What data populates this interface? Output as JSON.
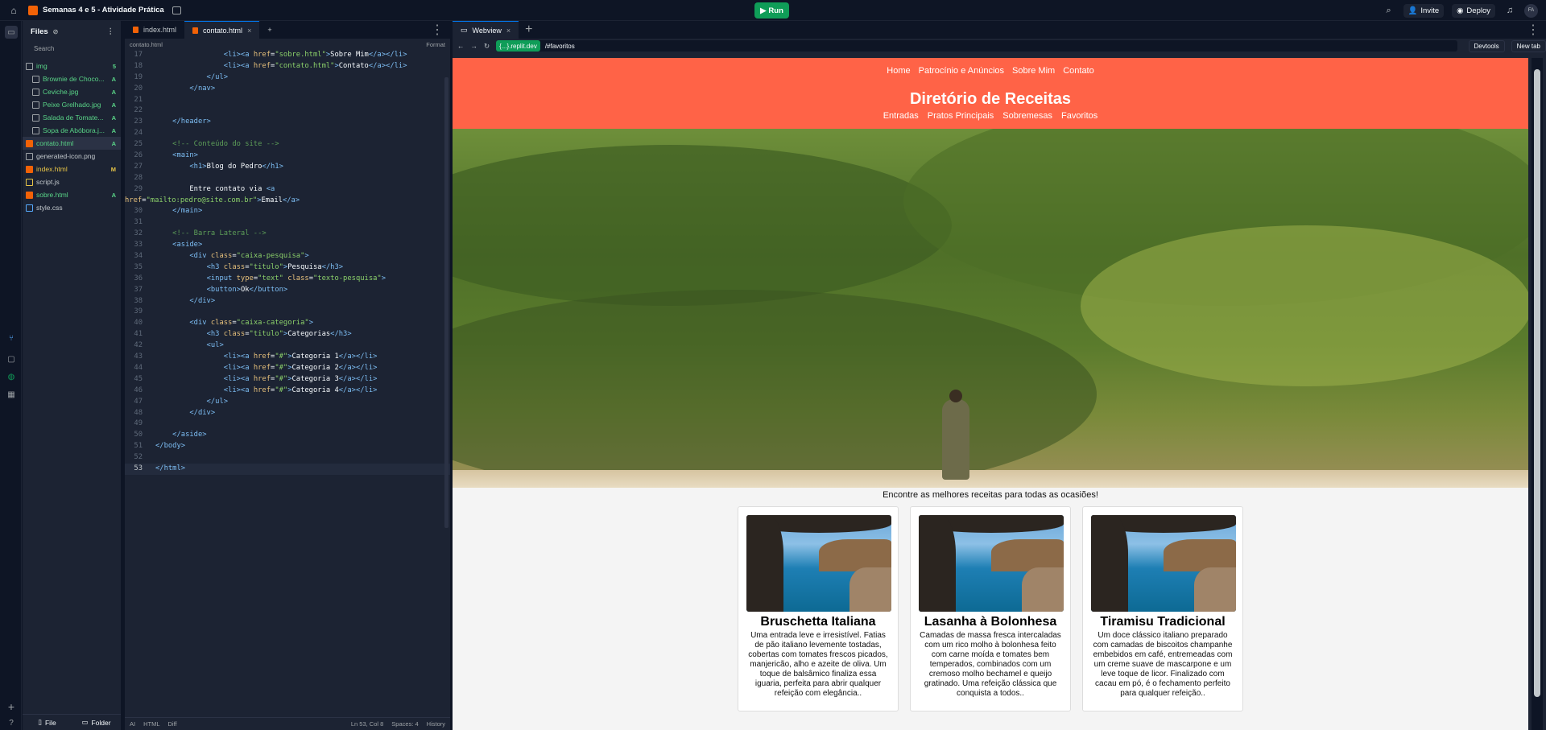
{
  "topbar": {
    "project_name": "Semanas 4 e 5 - Atividade Prática",
    "run_label": "Run",
    "invite_label": "Invite",
    "deploy_label": "Deploy",
    "avatar_initials": "FA"
  },
  "files": {
    "title": "Files",
    "search_placeholder": "Search",
    "items": [
      {
        "name": "img",
        "status": "5",
        "type": "folder",
        "color": "#59d487"
      },
      {
        "name": "Brownie de Choco...",
        "status": "A",
        "type": "image",
        "color": "#59d487"
      },
      {
        "name": "Ceviche.jpg",
        "status": "A",
        "type": "image",
        "color": "#59d487"
      },
      {
        "name": "Peixe Grelhado.jpg",
        "status": "A",
        "type": "image",
        "color": "#59d487"
      },
      {
        "name": "Salada de Tomate...",
        "status": "A",
        "type": "image",
        "color": "#59d487"
      },
      {
        "name": "Sopa de Abóbora.j...",
        "status": "A",
        "type": "image",
        "color": "#59d487"
      },
      {
        "name": "contato.html",
        "status": "A",
        "type": "html",
        "color": "#59d487"
      },
      {
        "name": "generated-icon.png",
        "status": "",
        "type": "image",
        "color": "#c2c8cc"
      },
      {
        "name": "index.html",
        "status": "M",
        "type": "html",
        "color": "#e8c547"
      },
      {
        "name": "script.js",
        "status": "",
        "type": "js",
        "color": "#c2c8cc"
      },
      {
        "name": "sobre.html",
        "status": "A",
        "type": "html",
        "color": "#59d487"
      },
      {
        "name": "style.css",
        "status": "",
        "type": "css",
        "color": "#c2c8cc"
      }
    ],
    "file_button": "File",
    "folder_button": "Folder"
  },
  "editor": {
    "tabs": [
      "index.html",
      "contato.html"
    ],
    "breadcrumb": "contato.html",
    "format_label": "Format",
    "status": {
      "ai": "AI",
      "lang": "HTML",
      "diff": "Diff",
      "position": "Ln 53, Col 8",
      "spaces": "Spaces: 4",
      "history": "History"
    }
  },
  "webview": {
    "tab_label": "Webview",
    "url_domain": "{...}.replit.dev",
    "url_path": "/#favoritos",
    "devtools_label": "Devtools",
    "newtab_label": "New tab"
  },
  "site": {
    "nav_top": [
      "Home",
      "Patrocínio e Anúncios",
      "Sobre Mim",
      "Contato"
    ],
    "title": "Diretório de Receitas",
    "nav_sub": [
      "Entradas",
      "Pratos Principais",
      "Sobremesas",
      "Favoritos"
    ],
    "tagline": "Encontre as melhores receitas para todas as ocasiões!",
    "cards": [
      {
        "title": "Bruschetta Italiana",
        "text": "Uma entrada leve e irresistível. Fatias de pão italiano levemente tostadas, cobertas com tomates frescos picados, manjericão, alho e azeite de oliva. Um toque de balsâmico finaliza essa iguaria, perfeita para abrir qualquer refeição com elegância.."
      },
      {
        "title": "Lasanha à Bolonhesa",
        "text": "Camadas de massa fresca intercaladas com um rico molho à bolonhesa feito com carne moída e tomates bem temperados, combinados com um cremoso molho bechamel e queijo gratinado. Uma refeição clássica que conquista a todos.."
      },
      {
        "title": "Tiramisu Tradicional",
        "text": "Um doce clássico italiano preparado com camadas de biscoitos champanhe embebidos em café, entremeadas com um creme suave de mascarpone e um leve toque de licor. Finalizado com cacau em pó, é o fechamento perfeito para qualquer refeição.."
      }
    ]
  }
}
